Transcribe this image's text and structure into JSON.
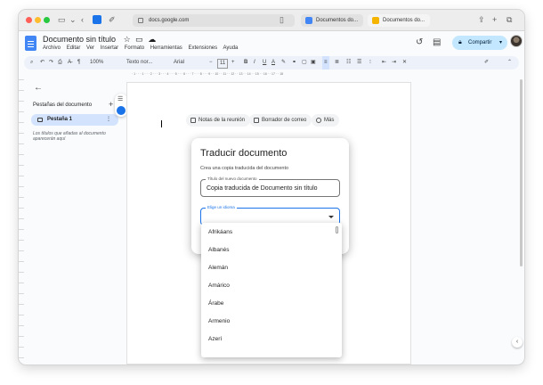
{
  "browser": {
    "address": "docs.google.com",
    "tabs": [
      {
        "label": "Documentos do..."
      },
      {
        "label": "Documentos do..."
      }
    ]
  },
  "docs": {
    "title": "Documento sin título",
    "menu": [
      "Archivo",
      "Editar",
      "Ver",
      "Insertar",
      "Formato",
      "Herramientas",
      "Extensiones",
      "Ayuda"
    ],
    "share_label": "Compartir"
  },
  "toolbar": {
    "zoom": "100%",
    "style": "Texto nor...",
    "font": "Arial",
    "size": "11"
  },
  "sidebar": {
    "title": "Pestañas del documento",
    "tab_label": "Pestaña 1",
    "note": "Los títulos que añadas al documento aparecerán aquí"
  },
  "page": {
    "chips": [
      "Notas de la reunión",
      "Borrador de correo",
      "Más"
    ]
  },
  "dialog": {
    "title": "Traducir documento",
    "subtitle": "Crea una copia traducida del documento",
    "name_label": "Título del nuevo documento",
    "name_value": "Copia traducida de Documento sin título",
    "lang_label": "Elige un idioma"
  },
  "languages": [
    "Afrikáans",
    "Albanés",
    "Alemán",
    "Amárico",
    "Árabe",
    "Armenio",
    "Azerí"
  ]
}
